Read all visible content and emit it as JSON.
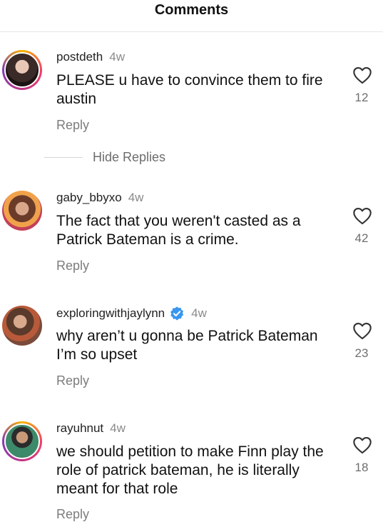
{
  "header": {
    "title": "Comments"
  },
  "comments": [
    {
      "username": "postdeth",
      "time": "4w",
      "text": "PLEASE u have to convince them to fire austin",
      "reply_label": "Reply",
      "likes": "12",
      "verified": false
    },
    {
      "username": "gaby_bbyxo",
      "time": "4w",
      "text": "The fact that you weren't casted as a Patrick Bateman is a crime.",
      "reply_label": "Reply",
      "likes": "42",
      "verified": false
    },
    {
      "username": "exploringwithjaylynn",
      "time": "4w",
      "text": "why aren’t u gonna be Patrick Bateman I’m so upset",
      "reply_label": "Reply",
      "likes": "23",
      "verified": true
    },
    {
      "username": "rayuhnut",
      "time": "4w",
      "text": "we should petition to make Finn play the role of patrick bateman, he is literally meant for that role",
      "reply_label": "Reply",
      "likes": "18",
      "verified": false
    }
  ],
  "hide_replies_label": "Hide Replies",
  "icons": {
    "like": "heart-outline-icon",
    "verified": "verified-badge-icon"
  },
  "colors": {
    "verified": "#3897f0",
    "muted": "#7c7c7c"
  }
}
